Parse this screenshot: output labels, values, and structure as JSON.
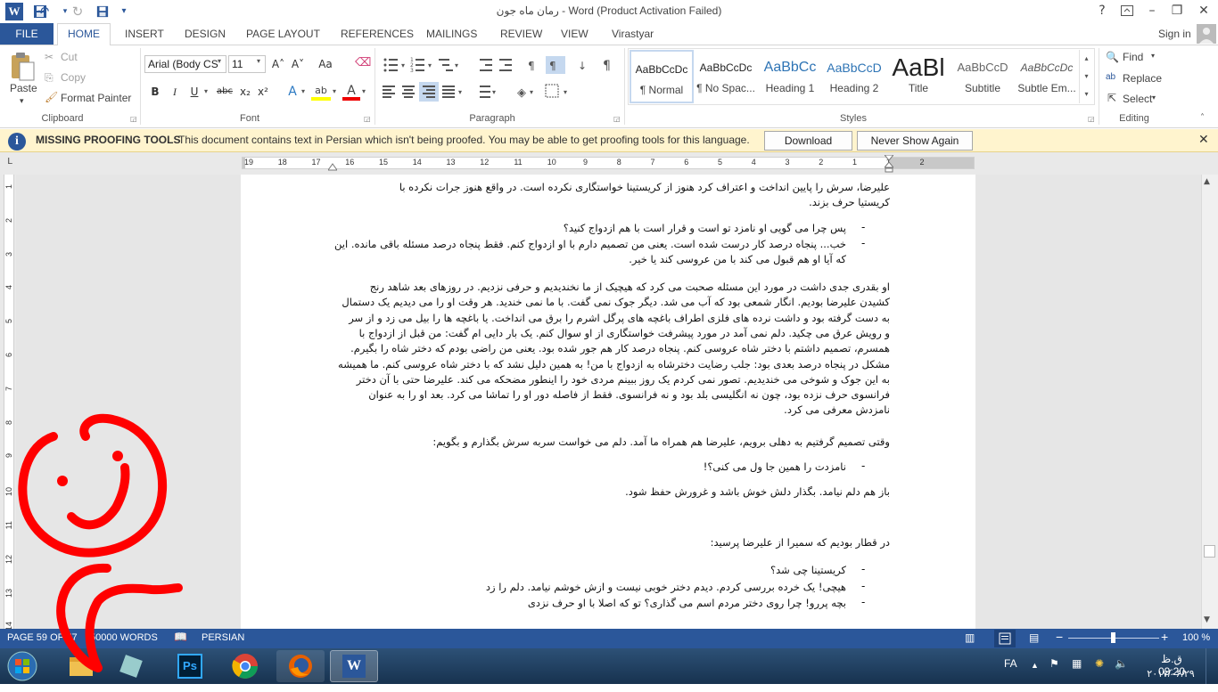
{
  "title": {
    "document_title": "رمان ماه جون - Word (Product Activation Failed)",
    "help": "?",
    "minimize": "–",
    "maximize": "❐",
    "close": "✕"
  },
  "tabs": {
    "file": "FILE",
    "home": "HOME",
    "insert": "INSERT",
    "design": "DESIGN",
    "page_layout": "PAGE LAYOUT",
    "references": "REFERENCES",
    "mailings": "MAILINGS",
    "review": "REVIEW",
    "view": "VIEW",
    "virastyar": "Virastyar",
    "sign_in": "Sign in"
  },
  "clipboard": {
    "paste": "Paste",
    "cut": "Cut",
    "copy": "Copy",
    "format_painter": "Format Painter",
    "label": "Clipboard"
  },
  "font": {
    "family": "Arial (Body CS",
    "size": "11",
    "label": "Font",
    "bold": "B",
    "italic": "I",
    "underline": "U",
    "strike": "abc",
    "sub": "x₂",
    "sup": "x²",
    "grow": "A˄",
    "shrink": "A˅",
    "case": "Aa",
    "effects": "A",
    "highlight": "ab",
    "color": "A"
  },
  "paragraph": {
    "label": "Paragraph",
    "show": "¶",
    "ltr": "¶",
    "rtl": "¶"
  },
  "styles": {
    "label": "Styles",
    "items": [
      {
        "sample": "AaBbCcDc",
        "name": "¶ Normal"
      },
      {
        "sample": "AaBbCcDc",
        "name": "¶ No Spac..."
      },
      {
        "sample": "AaBbCc",
        "name": "Heading 1"
      },
      {
        "sample": "AaBbCcD",
        "name": "Heading 2"
      },
      {
        "sample": "AaBl",
        "name": "Title"
      },
      {
        "sample": "AaBbCcD",
        "name": "Subtitle"
      },
      {
        "sample": "AaBbCcDc",
        "name": "Subtle Em..."
      }
    ]
  },
  "editing": {
    "find": "Find",
    "replace": "Replace",
    "select": "Select",
    "label": "Editing"
  },
  "message_bar": {
    "title": "MISSING PROOFING TOOLS",
    "text": "This document contains text in Persian which isn't being proofed. You may be able to get proofing tools for this language.",
    "download": "Download",
    "never_show": "Never Show Again"
  },
  "ruler": {
    "h_numbers": [
      "19",
      "18",
      "17",
      "16",
      "15",
      "14",
      "13",
      "12",
      "11",
      "10",
      "9",
      "8",
      "7",
      "6",
      "5",
      "4",
      "3",
      "2",
      "1",
      "1",
      "2"
    ],
    "v_numbers": [
      "1",
      "2",
      "3",
      "4",
      "5",
      "6",
      "7",
      "8",
      "9",
      "10",
      "11",
      "12",
      "13",
      "14"
    ]
  },
  "document": {
    "p1": [
      "علیرضا، سرش را پایین انداخت و اعتراف کرد هنوز از کریستینا خواستگاری نکرده است. در واقع هنوز جرات نکرده با",
      "کریستیا حرف بزند."
    ],
    "b1": "پس چرا می گویی او نامزد تو است و قرار است با هم ازدواج کنید؟",
    "b2": [
      "خب... پنجاه درصد کار درست شده است. یعنی من تصمیم دارم با او ازدواج کنم. فقط پنجاه درصد مسئله باقی مانده. این",
      "که آیا او هم قبول می کند با من عروسی کند یا خیر."
    ],
    "p2": [
      "او بقدری جدی داشت در مورد این مسئله صحبت می کرد که هیچیک از ما نخندیدیم و حرفی نزدیم. در روزهای بعد شاهد رنج",
      "کشیدن علیرضا بودیم. انگار شمعی بود که آب می شد. دیگر جوک نمی گفت. با ما نمی خندید. هر وقت او را می دیدیم یک دستمال",
      "به دست گرفته بود و داشت نرده های فلزی اطراف باغچه های پرگل اشرم را برق می انداخت. یا باغچه ها را بیل می زد و از سر",
      "و رویش عرق می چکید. دلم نمی آمد در مورد پیشرفت خواستگاری از او سوال کنم. یک بار دایی ام گفت: من قبل از ازدواج با",
      "همسرم، تصمیم داشتم با دختر شاه عروسی کنم. پنجاه درصد کار هم جور شده بود. یعنی من راضی بودم که دختر شاه را بگیرم.",
      "مشکل در پنجاه درصد بعدی بود: جلب رضایت دخترشاه به ازدواج با من! به همین دلیل نشد که با دختر شاه عروسی کنم. ما همیشه",
      "به این جوک و شوخی می خندیدیم. تصور نمی کردم یک روز ببینم مردی خود را اینطور مضحکه می کند. علیرضا حتی با آن دختر",
      "فرانسوی حرف نزده بود، چون نه انگلیسی بلد بود و نه فرانسوی. فقط از فاصله دور او را تماشا می کرد. بعد او را به عنوان",
      "نامزدش معرفی می کرد."
    ],
    "p3": "وقتی تصمیم گرفتیم به دهلی برویم، علیرضا هم همراه ما آمد. دلم می خواست سربه سرش بگذارم و بگویم:",
    "b3": "نامزدت را همین جا ول می کنی؟!",
    "p4": "باز هم دلم نیامد. بگذار دلش خوش باشد و غرورش حفظ شود.",
    "p5": "در قطار بودیم که سمیرا از علیرضا پرسید:",
    "b4": "کریستینا چی شد؟",
    "b5": "هیچی! یک خرده بررسی کردم. دیدم دختر خوبی نیست و ازش خوشم نیامد. دلم را زد",
    "b6": "بچه پررو! چرا روی دختر مردم اسم می گذاری؟ تو که اصلا با او حرف نزدی"
  },
  "status": {
    "page": "PAGE 59 OF 77",
    "words": "50000 WORDS",
    "language": "PERSIAN",
    "zoom": "100 %"
  },
  "taskbar": {
    "lang": "FA",
    "time": "ق.ظ 09:20",
    "date": "۲۰۱۷/۰۶/۲۹"
  },
  "colors": {
    "word_blue": "#2b579a",
    "message_bar": "#fff4ce",
    "annotation_red": "#ff0000"
  }
}
